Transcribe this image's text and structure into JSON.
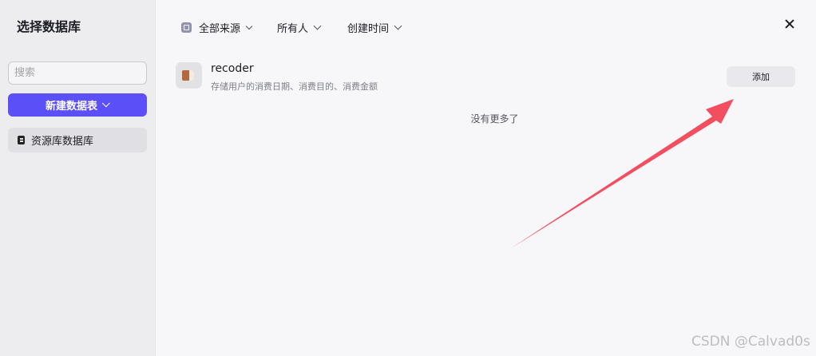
{
  "sidebar": {
    "title": "选择数据库",
    "search_placeholder": "搜索",
    "new_button_label": "新建数据表",
    "items": [
      {
        "label": "资源库数据库",
        "icon": "database-icon"
      }
    ]
  },
  "filters": {
    "source": "全部来源",
    "owner": "所有人",
    "created": "创建时间"
  },
  "result": {
    "title": "recoder",
    "description": "存储用户的消费日期、消费目的、消费金额",
    "add_label": "添加",
    "thumbnail_icon": "book-icon"
  },
  "empty_text": "没有更多了",
  "annotation": {
    "color": "#f24e60"
  },
  "watermark": "CSDN @Calvad0s",
  "colors": {
    "accent": "#5b4ff7",
    "sidebar_bg": "#ededf0",
    "main_bg": "#f7f7f9"
  }
}
